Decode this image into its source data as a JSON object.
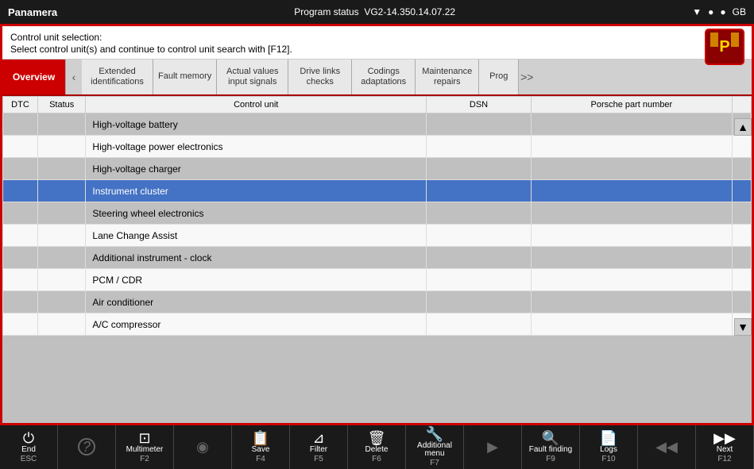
{
  "topbar": {
    "title": "Panamera",
    "program_status_label": "Program status",
    "version": "VG2-14.350.14.07.22",
    "region": "GB",
    "icons": {
      "wifi": "▼",
      "dot1": "●",
      "dot2": "●"
    }
  },
  "info": {
    "line1": "Control unit selection:",
    "line2": "Select control unit(s) and continue to control unit search with [F12]."
  },
  "tabs": [
    {
      "id": "overview",
      "label": "Overview",
      "state": "active"
    },
    {
      "id": "arrow-left",
      "label": "<",
      "state": "arrow"
    },
    {
      "id": "ext-id",
      "label": "Extended\nidentifications",
      "state": "inactive"
    },
    {
      "id": "fault-mem",
      "label": "Fault memory",
      "state": "inactive"
    },
    {
      "id": "actual-val",
      "label": "Actual values\ninput signals",
      "state": "inactive"
    },
    {
      "id": "drive-links",
      "label": "Drive links\nchecks",
      "state": "inactive"
    },
    {
      "id": "codings",
      "label": "Codings\nadaptations",
      "state": "inactive"
    },
    {
      "id": "maintenance",
      "label": "Maintenance\nrepairs",
      "state": "inactive"
    },
    {
      "id": "prog",
      "label": "Prog",
      "state": "inactive"
    },
    {
      "id": "arrow-right",
      "label": ">>",
      "state": "arrow"
    }
  ],
  "table": {
    "headers": [
      {
        "id": "dtc",
        "label": "DTC"
      },
      {
        "id": "status",
        "label": "Status"
      },
      {
        "id": "control-unit",
        "label": "Control unit"
      },
      {
        "id": "dsn",
        "label": "DSN"
      },
      {
        "id": "part-number",
        "label": "Porsche part number"
      }
    ],
    "rows": [
      {
        "dtc": "",
        "status": "",
        "control_unit": "High-voltage battery",
        "dsn": "",
        "part_number": "",
        "selected": false
      },
      {
        "dtc": "",
        "status": "",
        "control_unit": "High-voltage power electronics",
        "dsn": "",
        "part_number": "",
        "selected": false
      },
      {
        "dtc": "",
        "status": "",
        "control_unit": "High-voltage charger",
        "dsn": "",
        "part_number": "",
        "selected": false
      },
      {
        "dtc": "",
        "status": "",
        "control_unit": "Instrument cluster",
        "dsn": "",
        "part_number": "",
        "selected": true
      },
      {
        "dtc": "",
        "status": "",
        "control_unit": "Steering wheel electronics",
        "dsn": "",
        "part_number": "",
        "selected": false
      },
      {
        "dtc": "",
        "status": "",
        "control_unit": "Lane Change Assist",
        "dsn": "",
        "part_number": "",
        "selected": false
      },
      {
        "dtc": "",
        "status": "",
        "control_unit": "Additional instrument - clock",
        "dsn": "",
        "part_number": "",
        "selected": false
      },
      {
        "dtc": "",
        "status": "",
        "control_unit": "PCM / CDR",
        "dsn": "",
        "part_number": "",
        "selected": false
      },
      {
        "dtc": "",
        "status": "",
        "control_unit": "Air conditioner",
        "dsn": "",
        "part_number": "",
        "selected": false
      },
      {
        "dtc": "",
        "status": "",
        "control_unit": "A/C compressor",
        "dsn": "",
        "part_number": "",
        "selected": false
      }
    ]
  },
  "toolbar": {
    "buttons": [
      {
        "id": "end",
        "label": "End",
        "key": "ESC",
        "icon": "⏻"
      },
      {
        "id": "help",
        "label": "",
        "key": "",
        "icon": "?"
      },
      {
        "id": "multimeter",
        "label": "Multimeter",
        "key": "F2",
        "icon": "⊡"
      },
      {
        "id": "f3",
        "label": "",
        "key": "",
        "icon": "◉"
      },
      {
        "id": "save",
        "label": "Save",
        "key": "F4",
        "icon": "📋"
      },
      {
        "id": "filter",
        "label": "Filter",
        "key": "F5",
        "icon": "⊿"
      },
      {
        "id": "delete",
        "label": "Delete",
        "key": "F6",
        "icon": "🗑"
      },
      {
        "id": "additional-menu",
        "label": "Additional menu",
        "key": "F7",
        "icon": "🔧"
      },
      {
        "id": "play",
        "label": "",
        "key": "",
        "icon": "▶"
      },
      {
        "id": "fault-finding",
        "label": "Fault finding",
        "key": "F9",
        "icon": "🔍"
      },
      {
        "id": "logs",
        "label": "Logs",
        "key": "F10",
        "icon": "📄"
      },
      {
        "id": "f11",
        "label": "",
        "key": "",
        "icon": "◀◀"
      },
      {
        "id": "next",
        "label": "Next",
        "key": "F12",
        "icon": "▶▶"
      }
    ]
  }
}
